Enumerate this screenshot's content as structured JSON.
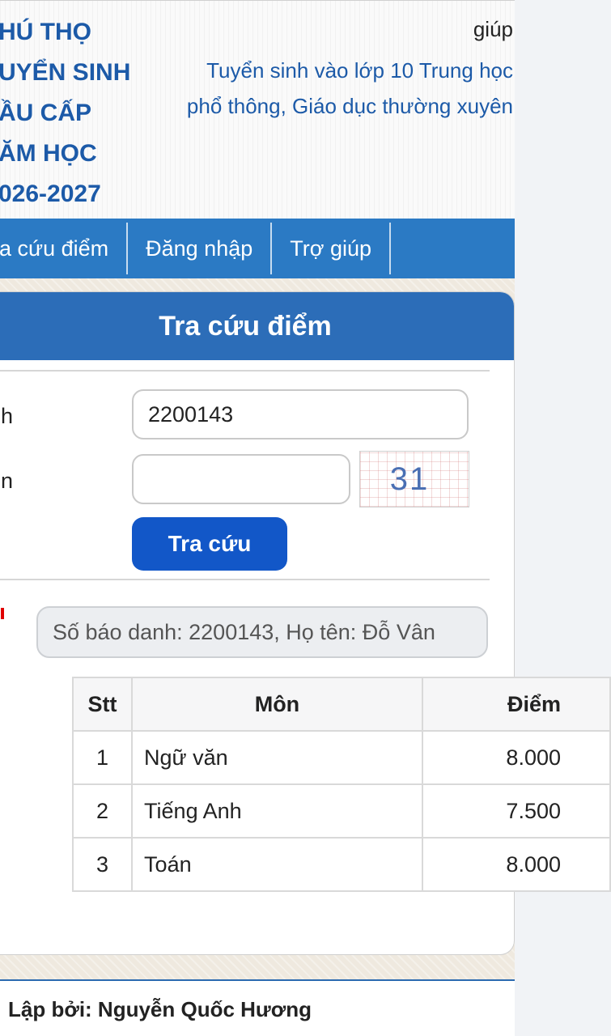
{
  "header": {
    "org_title": "HÚ THỌ\nUYỂN SINH\nẦU CẤP\nĂM HỌC\n026-2027",
    "help_link": "giúp",
    "subtitle": "Tuyển sinh vào lớp 10 Trung học phổ thông, Giáo dục thường xuyên"
  },
  "nav": {
    "items": [
      "ra cứu điểm",
      "Đăng nhập",
      "Trợ giúp"
    ]
  },
  "card": {
    "title": "Tra cứu điểm",
    "fields": {
      "sbd_label": "h",
      "sbd_value": "2200143",
      "captcha_label": "n",
      "captcha_value": "",
      "captcha_code": "31"
    },
    "submit_label": "Tra cứu",
    "result_text": "Số báo danh: 2200143, Họ tên: Đỗ Vân"
  },
  "scores": {
    "headers": [
      "Stt",
      "Môn",
      "Điểm"
    ],
    "rows": [
      {
        "stt": "1",
        "subject": "Ngữ văn",
        "score": "8.000"
      },
      {
        "stt": "2",
        "subject": "Tiếng Anh",
        "score": "7.500"
      },
      {
        "stt": "3",
        "subject": "Toán",
        "score": "8.000"
      }
    ]
  },
  "footer": {
    "text": "Lập bởi: Nguyễn Quốc Hương"
  },
  "colors": {
    "brand_blue": "#2b7ac4",
    "card_header": "#2c6db8",
    "button": "#1257c8",
    "title_text": "#1c5aa8"
  }
}
